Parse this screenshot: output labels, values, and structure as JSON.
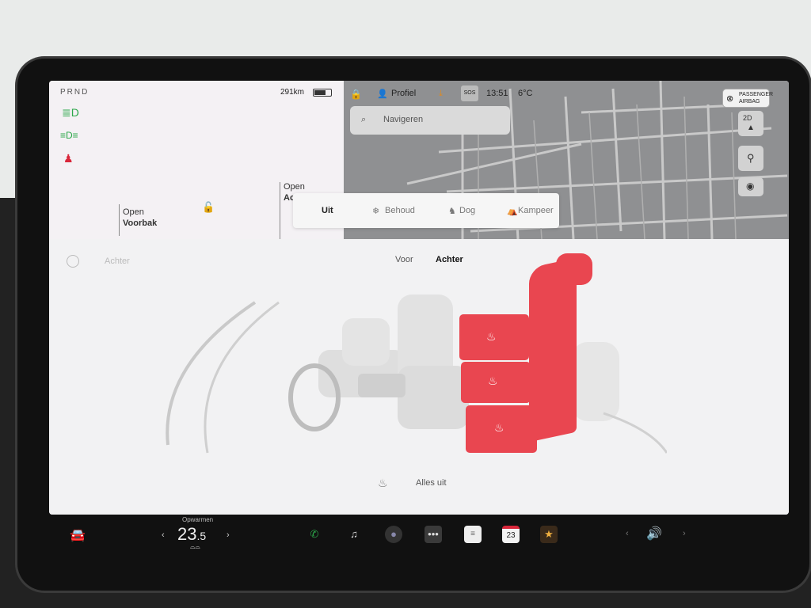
{
  "status": {
    "gear": "PRND",
    "range": "291km",
    "profile_label": "Profiel",
    "time": "13:51",
    "temperature": "6°C",
    "sos_label": "SOS",
    "passenger_airbag_line1": "PASSENGER",
    "passenger_airbag_line2": "AIRBAG"
  },
  "navigation": {
    "search_placeholder": "Navigeren",
    "map_button_label": "2D"
  },
  "left_panel": {
    "frunk_open_label": "Open",
    "frunk_label": "Voorbak",
    "trunk_open_label": "Open",
    "trunk_label_partial": "Ac",
    "rear_label": "Achter"
  },
  "climate_mode": {
    "options": [
      "Uit",
      "Behoud",
      "Dog",
      "Kampeer"
    ]
  },
  "seat_heater": {
    "tab_front": "Voor",
    "tab_rear": "Achter",
    "all_off_label": "Alles uit"
  },
  "climate": {
    "label": "Opwarmen",
    "temperature": "23.5",
    "temperature_int": "23",
    "temperature_dec": ".5"
  },
  "dock": {
    "calendar_day": "23"
  },
  "colors": {
    "accent_red": "#e94650",
    "icon_green": "#2ca84a"
  }
}
